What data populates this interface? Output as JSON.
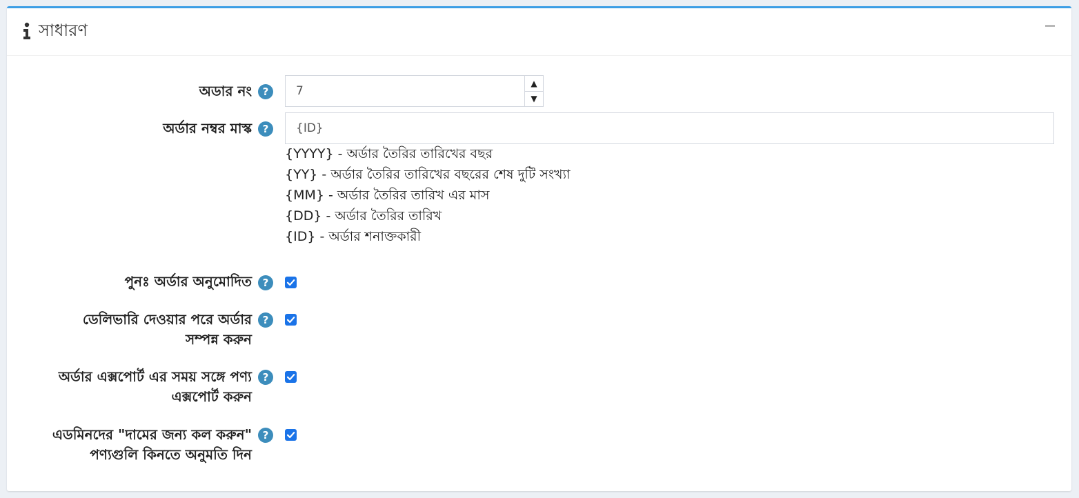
{
  "panel": {
    "title": "সাধারণ",
    "icon": "info-icon",
    "collapse_icon": "minus-icon"
  },
  "fields": {
    "order_no": {
      "label": "অডার নং",
      "value": "7"
    },
    "order_mask": {
      "label": "অর্ডার নম্বর মাস্ক",
      "value": "{ID}",
      "hints": [
        "{YYYY} - অর্ডার তৈরির তারিখের বছর",
        "{YY} - অর্ডার তৈরির তারিখের বছরের শেষ দুটি সংখ্যা",
        "{MM} - অর্ডার তৈরির তারিখ এর মাস",
        "{DD} - অর্ডার তৈরির তারিখ",
        "{ID} - অর্ডার শনাক্তকারী"
      ]
    },
    "reorder": {
      "label": "পুনঃ অর্ডার অনুমোদিত",
      "checked": true
    },
    "complete_after_delivery": {
      "label_line1": "ডেলিভারি দেওয়ার পরে অর্ডার",
      "label_line2": "সম্পন্ন করুন",
      "checked": true
    },
    "export_products": {
      "label_line1": "অর্ডার এক্সপোর্ট এর সময় সঙ্গে পণ্য",
      "label_line2": "এক্সপোর্ট করুন",
      "checked": true
    },
    "call_for_price": {
      "label_line1": "এডমিনদের \"দামের জন্য কল করুন\"",
      "label_line2": "পণ্যগুলি কিনতে অনুমতি দিন",
      "checked": true
    }
  },
  "help_glyph": "?",
  "spinner": {
    "up": "▲",
    "down": "▼"
  },
  "colors": {
    "accent": "#3c9ee5",
    "help": "#3c8dbc",
    "checkbox": "#1a73e8"
  }
}
